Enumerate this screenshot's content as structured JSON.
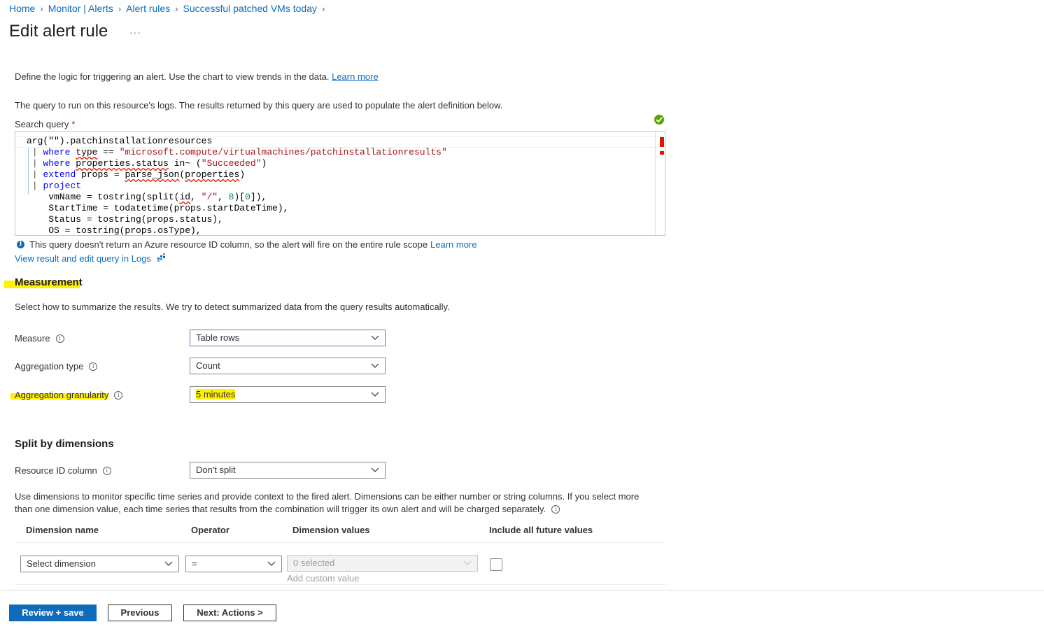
{
  "breadcrumb": [
    "Home",
    "Monitor | Alerts",
    "Alert rules",
    "Successful patched VMs today"
  ],
  "page": {
    "title": "Edit alert rule",
    "more": "···"
  },
  "intro": {
    "text": "Define the logic for triggering an alert. Use the chart to view trends in the data.",
    "link": "Learn more"
  },
  "query_section": {
    "description": "The query to run on this resource's logs. The results returned by this query are used to populate the alert definition below.",
    "label": "Search query",
    "required_mark": "*",
    "lines": [
      "arg(\"\").patchinstallationresources",
      "| where type == \"microsoft.compute/virtualmachines/patchinstallationresults\"",
      "| where properties.status in~ (\"Succeeded\")",
      "| extend props = parse_json(properties)",
      "| project",
      "    vmName = tostring(split(id, \"/\", 8)[0]),",
      "    StartTime = todatetime(props.startDateTime),",
      "    Status = tostring(props.status),",
      "    OS = tostring(props.osType),"
    ],
    "info": "This query doesn't return an Azure resource ID column, so the alert will fire on the entire rule scope",
    "info_link": "Learn more",
    "logs_link": "View result and edit query in Logs"
  },
  "measurement": {
    "heading": "Measurement",
    "description": "Select how to summarize the results. We try to detect summarized data from the query results automatically.",
    "measure_label": "Measure",
    "measure_value": "Table rows",
    "aggregation_type_label": "Aggregation type",
    "aggregation_type_value": "Count",
    "aggregation_granularity_label": "Aggregation granularity",
    "aggregation_granularity_value": "5 minutes"
  },
  "split": {
    "heading": "Split by dimensions",
    "resource_id_label": "Resource ID column",
    "resource_id_value": "Don't split",
    "description_line1": "Use dimensions to monitor specific time series and provide context to the fired alert. Dimensions can be either number or string columns. If you select more",
    "description_line2": "than one dimension value, each time series that results from the combination will trigger its own alert and will be charged separately.",
    "columns": [
      "Dimension name",
      "Operator",
      "Dimension values",
      "Include all future values"
    ],
    "row": {
      "dimension_placeholder": "Select dimension",
      "operator": "=",
      "values": "0 selected",
      "custom_value": "Add custom value"
    }
  },
  "footer": {
    "review_save": "Review + save",
    "previous": "Previous",
    "next": "Next: Actions >"
  },
  "colors": {
    "accent": "#0f6cbd",
    "highlight": "#fff100",
    "success": "#57a300",
    "error": "#e51400"
  }
}
